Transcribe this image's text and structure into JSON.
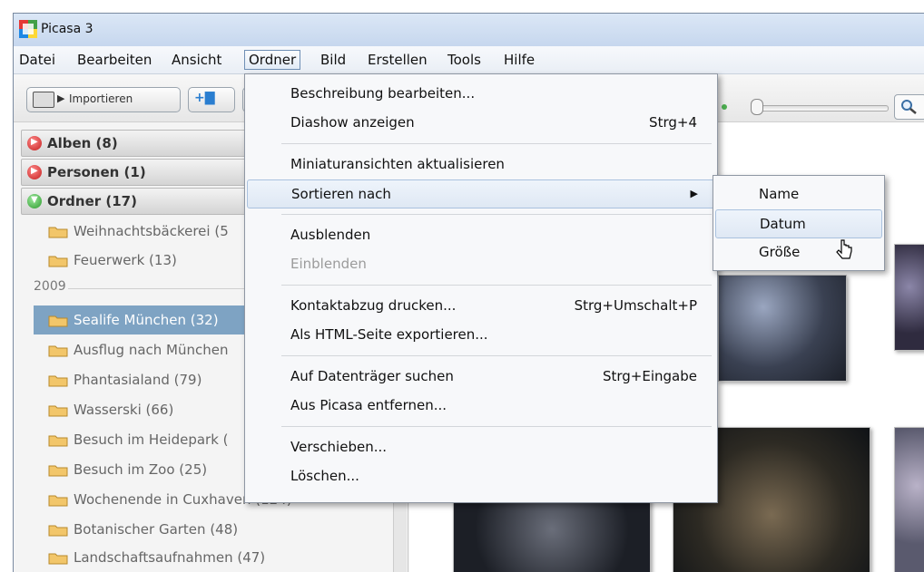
{
  "window": {
    "title": "Picasa 3"
  },
  "menubar": {
    "items": [
      "Datei",
      "Bearbeiten",
      "Ansicht",
      "Ordner",
      "Bild",
      "Erstellen",
      "Tools",
      "Hilfe"
    ],
    "active": "Ordner"
  },
  "toolbar": {
    "import_label": "Importieren"
  },
  "sidebar": {
    "sections": [
      {
        "label": "Alben (8)",
        "state": "collapsed"
      },
      {
        "label": "Personen (1)",
        "state": "collapsed"
      },
      {
        "label": "Ordner (17)",
        "state": "expanded"
      }
    ],
    "folders_top": [
      "Weihnachtsbäckerei (5",
      "Feuerwerk (13)"
    ],
    "year": "2009",
    "folders": [
      "Sealife München (32)",
      "Ausflug nach München",
      "Phantasialand (79)",
      "Wasserski (66)",
      "Besuch im Heidepark (",
      "Besuch im Zoo (25)",
      "Wochenende in Cuxhaven (124)",
      "Botanischer Garten (48)",
      "Landschaftsaufnahmen (47)"
    ],
    "selected_folder": "Sealife München (32)"
  },
  "folder_menu": {
    "items": [
      {
        "label": "Beschreibung bearbeiten...",
        "shortcut": ""
      },
      {
        "label": "Diashow anzeigen",
        "shortcut": "Strg+4"
      },
      {
        "label": "Miniaturansichten aktualisieren",
        "shortcut": ""
      },
      {
        "label": "Sortieren nach",
        "shortcut": ""
      },
      {
        "label": "Ausblenden",
        "shortcut": ""
      },
      {
        "label": "Einblenden",
        "shortcut": ""
      },
      {
        "label": "Kontaktabzug drucken...",
        "shortcut": "Strg+Umschalt+P"
      },
      {
        "label": "Als HTML-Seite exportieren...",
        "shortcut": ""
      },
      {
        "label": "Auf Datenträger suchen",
        "shortcut": "Strg+Eingabe"
      },
      {
        "label": "Aus Picasa entfernen...",
        "shortcut": ""
      },
      {
        "label": "Verschieben...",
        "shortcut": ""
      },
      {
        "label": "Löschen...",
        "shortcut": ""
      }
    ],
    "highlighted": "Sortieren nach",
    "disabled": [
      "Einblenden"
    ]
  },
  "sort_submenu": {
    "items": [
      "Name",
      "Datum",
      "Größe"
    ],
    "highlighted": "Datum"
  },
  "colors": {
    "selection": "#7ea3c3",
    "menu_highlight": "#dfe8f4"
  }
}
